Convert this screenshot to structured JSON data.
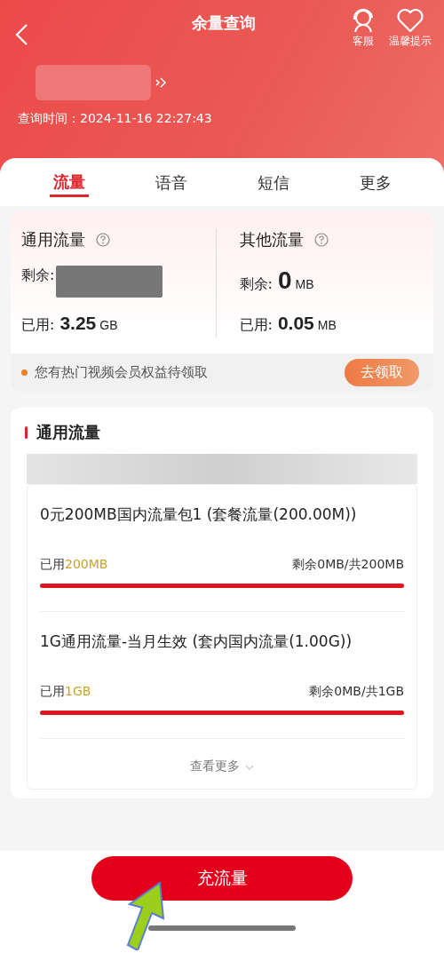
{
  "header": {
    "title": "余量查询",
    "actions": [
      {
        "label": "客服",
        "kind": "service"
      },
      {
        "label": "温馨提示",
        "kind": "heart"
      }
    ],
    "query_time": "查询时间：2024-11-16 22:27:43"
  },
  "tabs": [
    {
      "label": "流量",
      "selected": true
    },
    {
      "label": "语音",
      "selected": false
    },
    {
      "label": "短信",
      "selected": false
    },
    {
      "label": "更多",
      "selected": false
    }
  ],
  "summary": [
    {
      "title": "通用流量",
      "remain_label": "剩余:",
      "used_label": "已用:",
      "used_value": "3.25",
      "used_unit": "GB"
    },
    {
      "title": "其他流量",
      "remain_label": "剩余:",
      "remain_value": "0",
      "remain_unit": "MB",
      "used_label": "已用:",
      "used_value": "0.05",
      "used_unit": "MB"
    }
  ],
  "notice": {
    "text": "您有热门视频会员权益待领取",
    "button": "去领取"
  },
  "section": {
    "title": "通用流量",
    "packages": [
      {
        "name": "0元200MB国内流量包1 (套餐流量(200.00M))",
        "used_label": "已用",
        "used_value": "200MB",
        "balance": "剩余0MB/共200MB",
        "level": 1
      },
      {
        "name": "1G通用流量-当月生效 (套内国内流量(1.00G))",
        "used_label": "已用",
        "used_value": "1GB",
        "balance": "剩余0MB/共1GB",
        "level": 1
      }
    ],
    "more": "查看更多"
  },
  "recharge_button": "充流量"
}
